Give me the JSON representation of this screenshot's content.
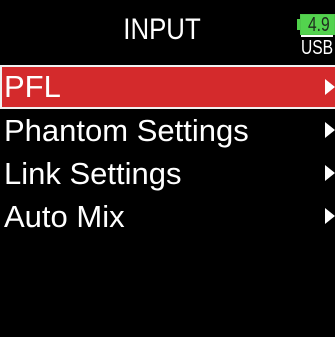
{
  "header": {
    "title": "INPUT",
    "battery": {
      "voltage": "4.9",
      "source": "USB",
      "color": "#53d34e"
    }
  },
  "menu": {
    "items": [
      {
        "label": "PFL",
        "selected": true,
        "icon": "chevron-right-icon"
      },
      {
        "label": "Phantom Settings",
        "selected": false,
        "icon": "chevron-right-icon"
      },
      {
        "label": "Link Settings",
        "selected": false,
        "icon": "chevron-right-icon"
      },
      {
        "label": "Auto Mix",
        "selected": false,
        "icon": "chevron-right-icon"
      }
    ],
    "highlight_color": "#d42a2c"
  }
}
